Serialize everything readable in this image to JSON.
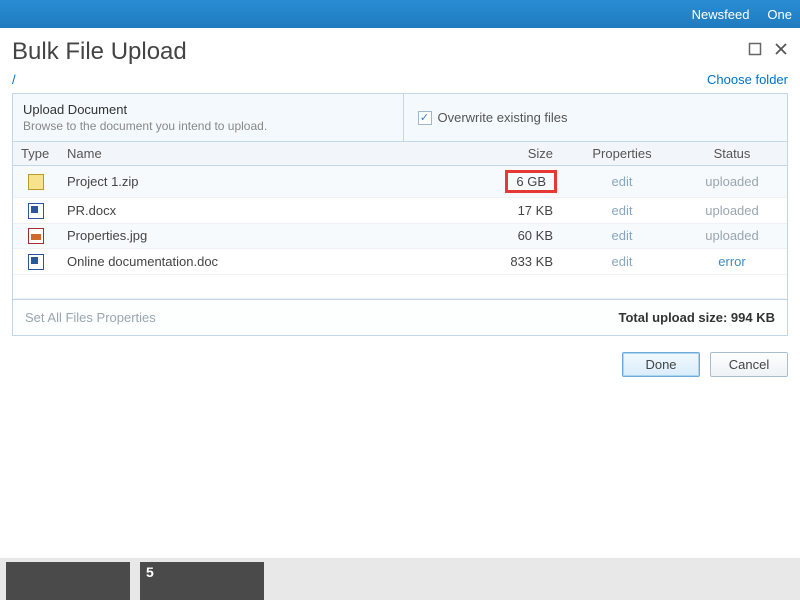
{
  "topnav": {
    "links": [
      "Newsfeed",
      "One"
    ]
  },
  "dialog": {
    "title": "Bulk File Upload",
    "breadcrumb": "/",
    "choose_folder": "Choose folder",
    "upload_heading": "Upload Document",
    "upload_subtext": "Browse to the document you intend to upload.",
    "overwrite_label": "Overwrite existing files",
    "set_all_label": "Set All Files Properties",
    "total_label": "Total upload size: 994 KB",
    "done_label": "Done",
    "cancel_label": "Cancel"
  },
  "columns": {
    "type": "Type",
    "name": "Name",
    "size": "Size",
    "properties": "Properties",
    "status": "Status"
  },
  "files": [
    {
      "icon": "zip",
      "name": "Project 1.zip",
      "size": "6 GB",
      "size_highlight": true,
      "props": "edit",
      "status": "uploaded",
      "status_kind": "done"
    },
    {
      "icon": "doc",
      "name": "PR.docx",
      "size": "17 KB",
      "props": "edit",
      "status": "uploaded",
      "status_kind": "done"
    },
    {
      "icon": "jpg",
      "name": "Properties.jpg",
      "size": "60 KB",
      "props": "edit",
      "status": "uploaded",
      "status_kind": "done"
    },
    {
      "icon": "doc",
      "name": "Online documentation.doc",
      "size": "833 KB",
      "props": "edit",
      "status": "error",
      "status_kind": "error"
    }
  ],
  "thumb_label": "5"
}
